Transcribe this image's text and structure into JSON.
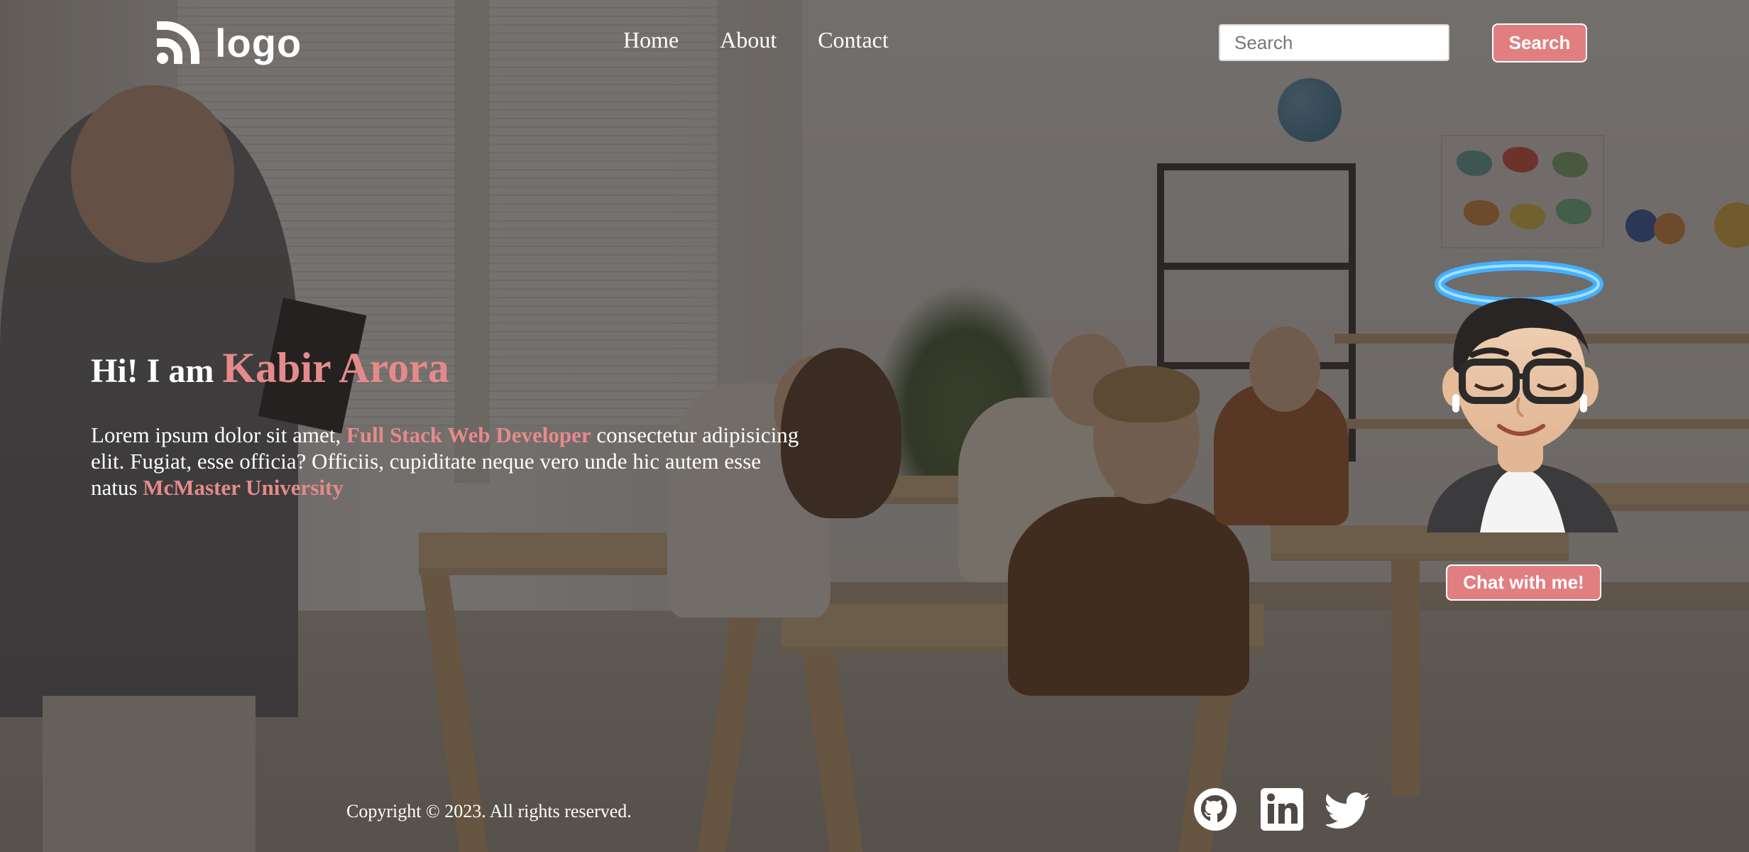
{
  "nav": {
    "logo_text": "logo",
    "links": [
      {
        "label": "Home"
      },
      {
        "label": "About"
      },
      {
        "label": "Contact"
      }
    ],
    "search": {
      "placeholder": "Search",
      "button_label": "Search"
    }
  },
  "hero": {
    "greeting": "Hi! I am ",
    "name": "Kabir Arora",
    "text_part1": "Lorem ipsum dolor sit amet, ",
    "highlight_role": "Full Stack Web Developer",
    "text_part2": " consectetur adipisicing elit. Fugiat, esse officia? Officiis, cupiditate neque vero unde hic autem esse natus ",
    "highlight_school": "McMaster University"
  },
  "chat": {
    "button_label": "Chat with me!"
  },
  "footer": {
    "copyright": "Copyright © 2023. All rights reserved.",
    "social_icons": [
      "github-icon",
      "linkedin-icon",
      "twitter-icon"
    ]
  },
  "colors": {
    "accent": "#e17f80",
    "highlight_text": "#e58a8b",
    "text": "#ffffff"
  }
}
